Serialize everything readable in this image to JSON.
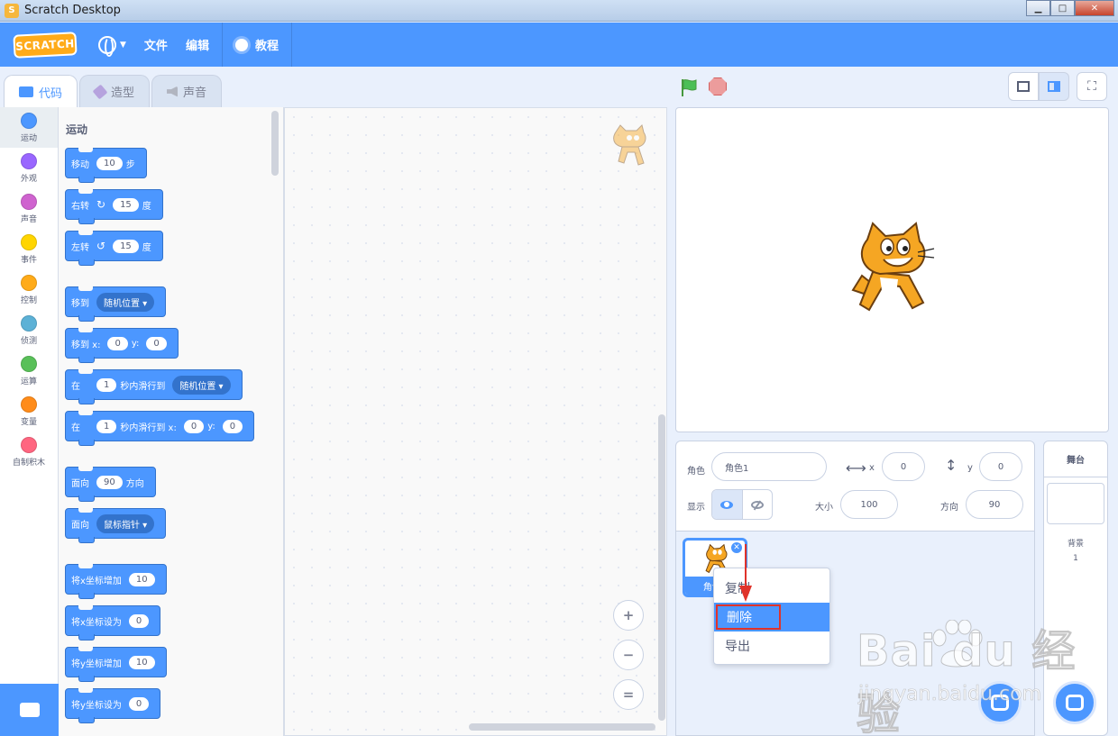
{
  "window": {
    "title": "Scratch Desktop",
    "controls": [
      "minimize",
      "maximize",
      "close"
    ]
  },
  "menubar": {
    "logo": "SCRATCH",
    "file": "文件",
    "edit": "编辑",
    "tutorials": "教程"
  },
  "tabs": [
    {
      "label": "代码",
      "active": true
    },
    {
      "label": "造型",
      "active": false
    },
    {
      "label": "声音",
      "active": false
    }
  ],
  "categories": [
    {
      "label": "运动",
      "color": "#4c97ff"
    },
    {
      "label": "外观",
      "color": "#9966ff"
    },
    {
      "label": "声音",
      "color": "#cf63cf"
    },
    {
      "label": "事件",
      "color": "#ffd500"
    },
    {
      "label": "控制",
      "color": "#ffab19"
    },
    {
      "label": "侦测",
      "color": "#5cb1d6"
    },
    {
      "label": "运算",
      "color": "#59c059"
    },
    {
      "label": "变量",
      "color": "#ff8c1a"
    },
    {
      "label": "自制积木",
      "color": "#ff6680"
    }
  ],
  "palette": {
    "title": "运动",
    "blocks": {
      "move": {
        "a": "移动",
        "n": "10",
        "b": "步"
      },
      "turn_right": {
        "a": "右转",
        "n": "15",
        "b": "度"
      },
      "turn_left": {
        "a": "左转",
        "n": "15",
        "b": "度"
      },
      "goto": {
        "a": "移到",
        "dd": "随机位置"
      },
      "goto_xy": {
        "a": "移到 x:",
        "x": "0",
        "b": "y:",
        "y": "0"
      },
      "glide": {
        "a": "在",
        "n": "1",
        "b": "秒内滑行到",
        "dd": "随机位置"
      },
      "glide_xy": {
        "a": "在",
        "n": "1",
        "b": "秒内滑行到 x:",
        "x": "0",
        "c": "y:",
        "y": "0"
      },
      "point_dir": {
        "a": "面向",
        "n": "90",
        "b": "方向"
      },
      "point_towards": {
        "a": "面向",
        "dd": "鼠标指针"
      },
      "change_x": {
        "a": "将x坐标增加",
        "n": "10"
      },
      "set_x": {
        "a": "将x坐标设为",
        "n": "0"
      },
      "change_y": {
        "a": "将y坐标增加",
        "n": "10"
      },
      "set_y": {
        "a": "将y坐标设为",
        "n": "0"
      }
    }
  },
  "zoom": {
    "in": "+",
    "out": "−",
    "reset": "="
  },
  "sprite_info": {
    "sprite_label": "角色",
    "sprite_name": "角色1",
    "x_label": "x",
    "x": "0",
    "y_label": "y",
    "y": "0",
    "show_label": "显示",
    "size_label": "大小",
    "size": "100",
    "direction_label": "方向",
    "direction": "90"
  },
  "sprite_tile": {
    "name": "角色1"
  },
  "context_menu": [
    {
      "label": "复制",
      "highlighted": false
    },
    {
      "label": "删除",
      "highlighted": true
    },
    {
      "label": "导出",
      "highlighted": false
    }
  ],
  "stage_pane": {
    "title": "舞台",
    "backdrop_label": "背景",
    "backdrop_count": "1"
  },
  "watermark": {
    "main": "Bai du 经验",
    "sub": "jingyan.baidu.com"
  }
}
